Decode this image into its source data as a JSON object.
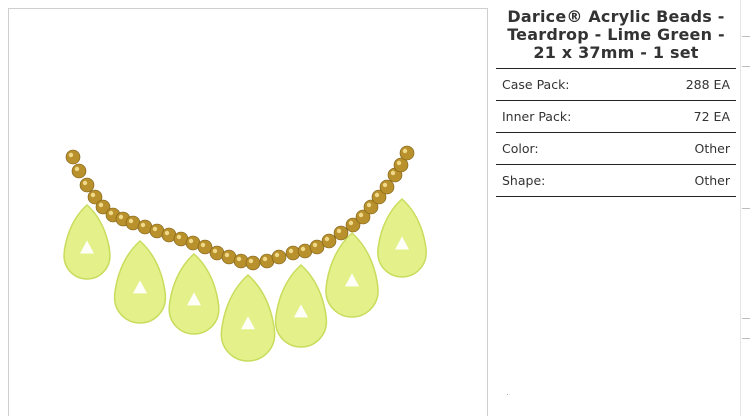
{
  "product": {
    "title": "Darice® Acrylic Beads - Teardrop - Lime Green - 21 x 37mm - 1 set",
    "image_alt": "Lime green teardrop acrylic beads on gold bead strand"
  },
  "specs": [
    {
      "label": "Case Pack:",
      "value": "288 EA"
    },
    {
      "label": "Inner Pack:",
      "value": "72 EA"
    },
    {
      "label": "Color:",
      "value": "Other"
    },
    {
      "label": "Shape:",
      "value": "Other"
    }
  ],
  "colors": {
    "bead_green": "#e4f08a",
    "bead_shadow": "#c9dc5c",
    "gold": "#b8912c"
  }
}
